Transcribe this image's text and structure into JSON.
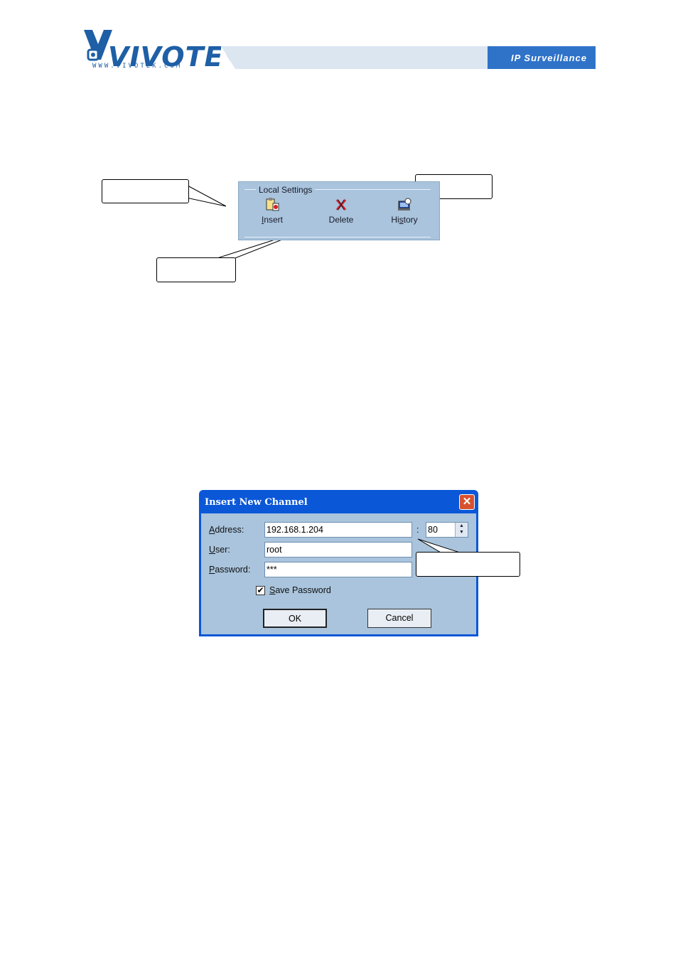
{
  "header": {
    "logo_text": "VIVOTEK",
    "logo_url": "WWW.VIVOTEK.COM",
    "banner_text": "IP Surveillance",
    "brand_color": "#1e5fa6"
  },
  "local_settings": {
    "title": "Local Settings",
    "buttons": [
      {
        "label_pre": "",
        "label_ul": "I",
        "label_post": "nsert",
        "icon": "insert-icon"
      },
      {
        "label_pre": "Delete",
        "label_ul": "",
        "label_post": "",
        "icon": "delete-icon"
      },
      {
        "label_pre": "Hi",
        "label_ul": "s",
        "label_post": "tory",
        "icon": "history-icon"
      }
    ]
  },
  "dialog": {
    "title": "Insert New Channel",
    "address_label_ul": "A",
    "address_label_rest": "ddress:",
    "address_value": "192.168.1.204",
    "port_separator": ":",
    "port_value": "80",
    "user_label_ul": "U",
    "user_label_rest": "ser:",
    "user_value": "root",
    "password_label_ul": "P",
    "password_label_rest": "assword:",
    "password_value": "***",
    "save_password_ul": "S",
    "save_password_rest": "ave Password",
    "save_password_checked": true,
    "ok_label": "OK",
    "cancel_label": "Cancel",
    "close_glyph": "✕"
  }
}
